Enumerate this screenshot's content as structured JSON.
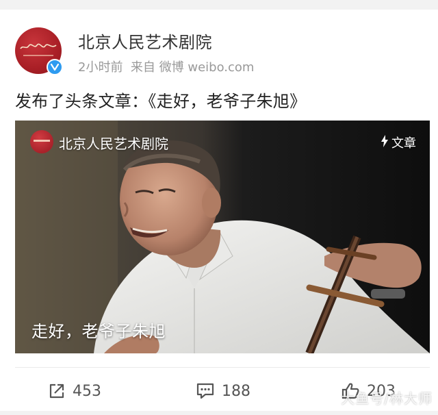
{
  "account": {
    "name": "北京人民艺术剧院",
    "time": "2小时前",
    "source_prefix": "来自",
    "source": "微博 weibo.com",
    "avatar_icon": "beijing-peoples-art-theatre-logo",
    "verified_icon": "verified-v-badge",
    "verified_color": "#2e9bf0"
  },
  "post": {
    "text": "发布了头条文章：《走好，老爷子朱旭》"
  },
  "article_card": {
    "source_name": "北京人民艺术剧院",
    "type_label": "文章",
    "type_icon": "lightning-icon",
    "caption": "走好，老爷子朱旭",
    "image": "photo-elderly-man-playing-erhu"
  },
  "actions": {
    "repost_count": "453",
    "comment_count": "188",
    "like_count": "203",
    "repost_icon": "share-icon",
    "comment_icon": "comment-icon",
    "like_icon": "thumbs-up-icon"
  },
  "watermark": "大鱼号/林大师"
}
